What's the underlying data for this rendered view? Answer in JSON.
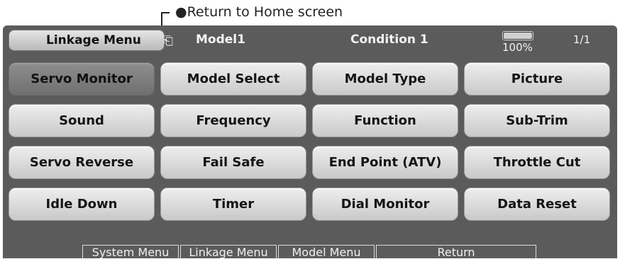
{
  "annotation": {
    "label": "●Return to Home screen"
  },
  "header": {
    "home_button": "Linkage Menu",
    "model_name": "Model1",
    "condition": "Condition 1",
    "battery": {
      "percent_label": "100%",
      "level": 1.0
    },
    "page_indicator": "1/1"
  },
  "menu": {
    "items": [
      {
        "label": "Servo Monitor",
        "selected": true
      },
      {
        "label": "Model Select"
      },
      {
        "label": "Model Type"
      },
      {
        "label": "Picture"
      },
      {
        "label": "Sound"
      },
      {
        "label": "Frequency"
      },
      {
        "label": "Function"
      },
      {
        "label": "Sub-Trim"
      },
      {
        "label": "Servo Reverse"
      },
      {
        "label": "Fail Safe"
      },
      {
        "label": "End Point (ATV)"
      },
      {
        "label": "Throttle Cut"
      },
      {
        "label": "Idle Down"
      },
      {
        "label": "Timer"
      },
      {
        "label": "Dial Monitor"
      },
      {
        "label": "Data Reset"
      }
    ]
  },
  "bottom_bar": {
    "items": [
      "System Menu",
      "Linkage Menu",
      "Model Menu",
      "Return"
    ]
  }
}
